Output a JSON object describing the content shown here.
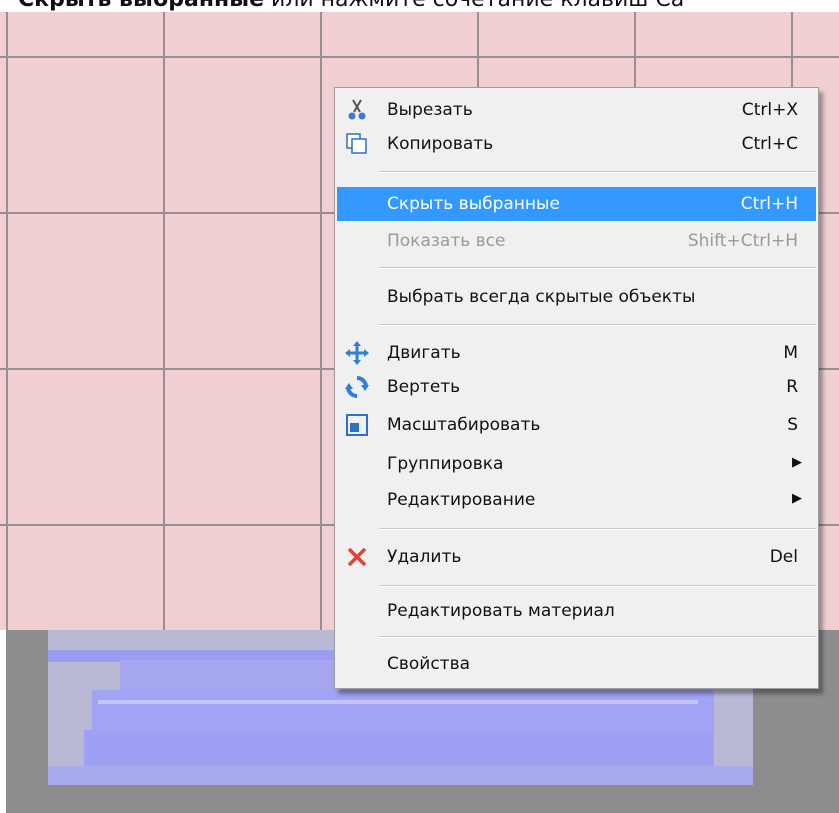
{
  "caption": {
    "bold": "Скрыть выбранные",
    "rest": " или нажмите сочетание клавиш Ca"
  },
  "menu": {
    "items": [
      {
        "label": "Вырезать",
        "shortcut": "Ctrl+X",
        "icon": "scissors-icon"
      },
      {
        "label": "Копировать",
        "shortcut": "Ctrl+C",
        "icon": "copy-icon"
      },
      {
        "label": "Скрыть выбранные",
        "shortcut": "Ctrl+H",
        "highlighted": true
      },
      {
        "label": "Показать все",
        "shortcut": "Shift+Ctrl+H",
        "disabled": true
      },
      {
        "label": "Выбрать всегда скрытые объекты"
      },
      {
        "label": "Двигать",
        "shortcut": "M",
        "icon": "move-arrows-icon"
      },
      {
        "label": "Вертеть",
        "shortcut": "R",
        "icon": "rotate-icon"
      },
      {
        "label": "Масштабировать",
        "shortcut": "S",
        "icon": "scale-icon"
      },
      {
        "label": "Группировка",
        "submenu": true
      },
      {
        "label": "Редактирование",
        "submenu": true
      },
      {
        "label": "Удалить",
        "shortcut": "Del",
        "icon": "delete-x-icon"
      },
      {
        "label": "Редактировать материал"
      },
      {
        "label": "Свойства"
      }
    ]
  },
  "colors": {
    "highlight": "#3399ff",
    "wall": "#efcfd1",
    "floor": "#8d8d8d",
    "object": "#9c9cf2",
    "delete_icon": "#e0443a",
    "move_icon": "#2f7fd6"
  }
}
